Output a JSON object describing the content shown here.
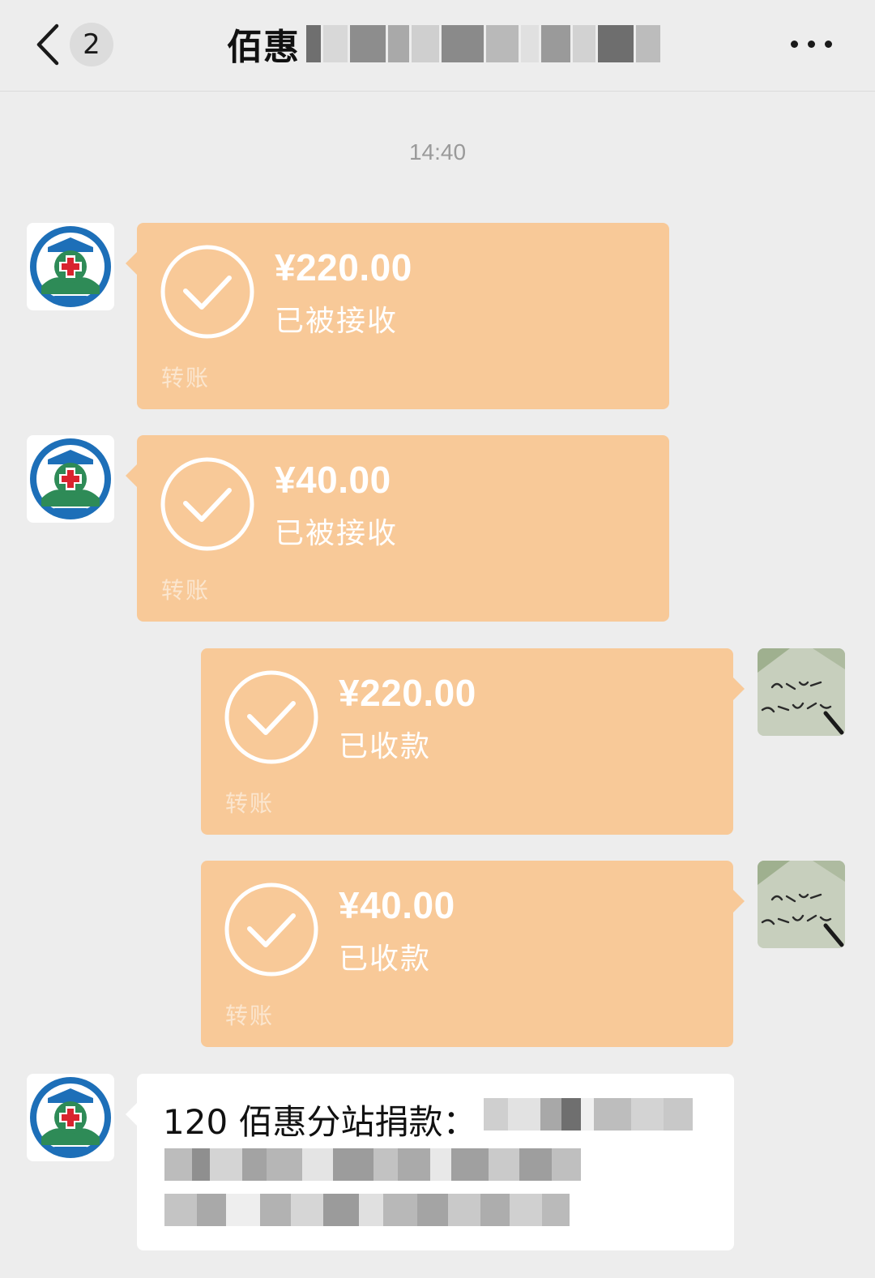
{
  "header": {
    "back_label": "",
    "unread_count": "2",
    "title": "佰惠",
    "more_icon": "more-dots-icon"
  },
  "messages": {
    "timestamp": "14:40",
    "transfers": [
      {
        "amount": "¥220.00",
        "status": "已被接收",
        "label": "转账"
      },
      {
        "amount": "¥40.00",
        "status": "已被接收",
        "label": "转账"
      },
      {
        "amount": "¥220.00",
        "status": "已收款",
        "label": "转账"
      },
      {
        "amount": "¥40.00",
        "status": "已收款",
        "label": "转账"
      }
    ],
    "text_message": {
      "text": "120 佰惠分站捐款："
    }
  },
  "colors": {
    "background": "#ededed",
    "transfer_bubble": "#f8c998",
    "text_bubble": "#ffffff",
    "avatar_emblem_blue": "#1d6fb8",
    "avatar_emblem_green": "#2e8b57",
    "avatar_cross_red": "#d9232e"
  }
}
